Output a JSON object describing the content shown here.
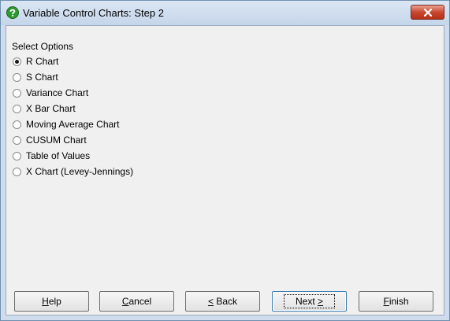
{
  "window": {
    "title": "Variable Control Charts: Step 2"
  },
  "options_group": {
    "label": "Select Options",
    "selected_index": 0,
    "items": [
      "R Chart",
      "S Chart",
      "Variance Chart",
      "X Bar Chart",
      "Moving Average Chart",
      "CUSUM Chart",
      "Table of Values",
      "X Chart (Levey-Jennings)"
    ]
  },
  "buttons": {
    "help": {
      "mn": "H",
      "rest": "elp"
    },
    "cancel": {
      "mn": "C",
      "rest": "ancel"
    },
    "back": {
      "mn": "<",
      "rest": " Back"
    },
    "next": {
      "pre": "Next ",
      "mn": ">"
    },
    "finish": {
      "mn": "F",
      "rest": "inish"
    }
  },
  "colors": {
    "title_bg": "#c5d6ea",
    "client_bg": "#f0f0f0",
    "close_btn": "#c9482f",
    "help_icon": "#2f9a2f"
  }
}
